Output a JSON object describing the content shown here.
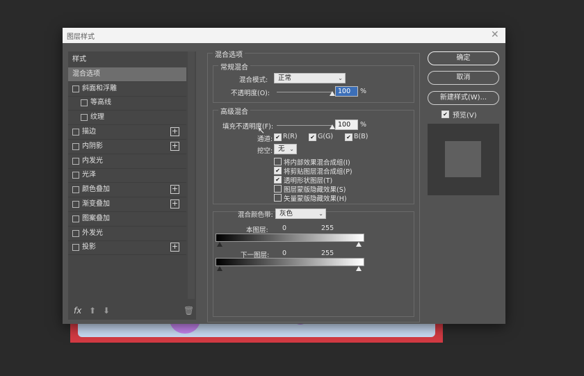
{
  "dialog": {
    "title": "图层样式",
    "close_icon": "close-icon"
  },
  "left_panel": {
    "items": [
      {
        "label": "样式",
        "checkbox": false,
        "indent": 0,
        "plus": false,
        "header": true
      },
      {
        "label": "混合选项",
        "checkbox": false,
        "indent": 0,
        "plus": false,
        "selected": true
      },
      {
        "label": "斜面和浮雕",
        "checkbox": true,
        "indent": 0,
        "plus": false
      },
      {
        "label": "等高线",
        "checkbox": true,
        "indent": 1,
        "plus": false
      },
      {
        "label": "纹理",
        "checkbox": true,
        "indent": 1,
        "plus": false
      },
      {
        "label": "描边",
        "checkbox": true,
        "indent": 0,
        "plus": true
      },
      {
        "label": "内阴影",
        "checkbox": true,
        "indent": 0,
        "plus": true
      },
      {
        "label": "内发光",
        "checkbox": true,
        "indent": 0,
        "plus": false
      },
      {
        "label": "光泽",
        "checkbox": true,
        "indent": 0,
        "plus": false
      },
      {
        "label": "颜色叠加",
        "checkbox": true,
        "indent": 0,
        "plus": true
      },
      {
        "label": "渐变叠加",
        "checkbox": true,
        "indent": 0,
        "plus": true
      },
      {
        "label": "图案叠加",
        "checkbox": true,
        "indent": 0,
        "plus": false
      },
      {
        "label": "外发光",
        "checkbox": true,
        "indent": 0,
        "plus": false
      },
      {
        "label": "投影",
        "checkbox": true,
        "indent": 0,
        "plus": true
      }
    ],
    "fx_label": "fx"
  },
  "main": {
    "section_title": "混合选项",
    "general": {
      "title": "常规混合",
      "mode_label": "混合模式:",
      "mode_value": "正常",
      "opacity_label": "不透明度(O):",
      "opacity_value": "100",
      "opacity_unit": "%",
      "opacity_level": 1.0
    },
    "advanced": {
      "title": "高级混合",
      "fill_label": "填充不透明度(F):",
      "fill_value": "100",
      "fill_unit": "%",
      "fill_level": 1.0,
      "channels_label": "通道:",
      "channels": [
        {
          "label": "R(R)",
          "checked": true
        },
        {
          "label": "G(G)",
          "checked": true
        },
        {
          "label": "B(B)",
          "checked": true
        }
      ],
      "knockout_label": "挖空:",
      "knockout_value": "无",
      "options": [
        {
          "label": "将内部效果混合成组(I)",
          "checked": false
        },
        {
          "label": "将剪贴图层混合成组(P)",
          "checked": true
        },
        {
          "label": "透明形状图层(T)",
          "checked": true
        },
        {
          "label": "图层蒙版隐藏效果(S)",
          "checked": false
        },
        {
          "label": "矢量蒙版隐藏效果(H)",
          "checked": false
        }
      ]
    },
    "blend_if": {
      "label": "混合颜色带:",
      "value": "灰色",
      "this_layer_label": "本图层:",
      "this_layer_min": "0",
      "this_layer_max": "255",
      "under_layer_label": "下一图层:",
      "under_layer_min": "0",
      "under_layer_max": "255"
    }
  },
  "buttons": {
    "ok": "确定",
    "cancel": "取消",
    "new_style": "新建样式(W)...",
    "preview_label": "预览(V)",
    "preview_checked": true
  }
}
